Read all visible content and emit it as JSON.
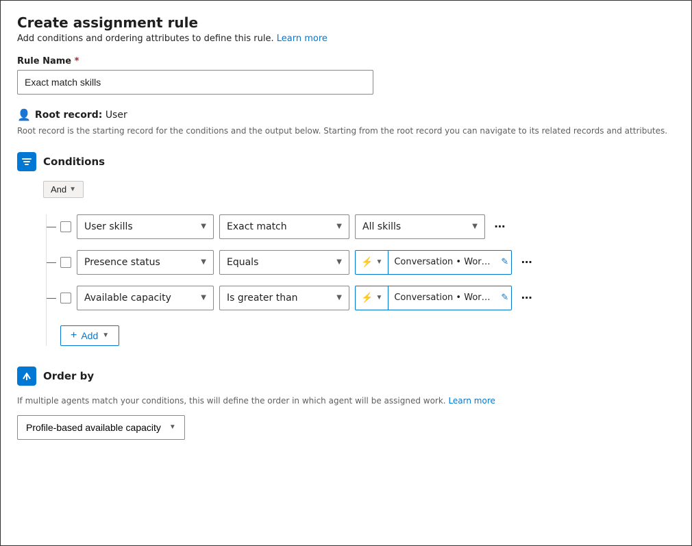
{
  "header": {
    "title": "Create assignment rule",
    "subtitle": "Add conditions and ordering attributes to define this rule.",
    "learn_more_label": "Learn more",
    "learn_more_url": "#"
  },
  "rule_name_field": {
    "label": "Rule Name",
    "required": true,
    "value": "Exact match skills",
    "placeholder": ""
  },
  "root_record": {
    "label": "Root record:",
    "value": "User",
    "description": "Root record is the starting record for the conditions and the output below. Starting from the root record you can navigate to its related records and attributes."
  },
  "conditions_section": {
    "title": "Conditions",
    "and_label": "And",
    "rows": [
      {
        "id": 1,
        "attribute": "User skills",
        "operator": "Exact match",
        "value_type": "static",
        "value": "All skills"
      },
      {
        "id": 2,
        "attribute": "Presence status",
        "operator": "Equals",
        "value_type": "dynamic",
        "value": "Conversation • Work Stream • All..."
      },
      {
        "id": 3,
        "attribute": "Available capacity",
        "operator": "Is greater than",
        "value_type": "dynamic",
        "value": "Conversation • Work Stream • Ca..."
      }
    ],
    "add_label": "Add"
  },
  "order_by_section": {
    "title": "Order by",
    "description": "If multiple agents match your conditions, this will define the order in which agent will be assigned work.",
    "learn_more_label": "Learn more",
    "learn_more_url": "#",
    "selected_value": "Profile-based available capacity"
  }
}
